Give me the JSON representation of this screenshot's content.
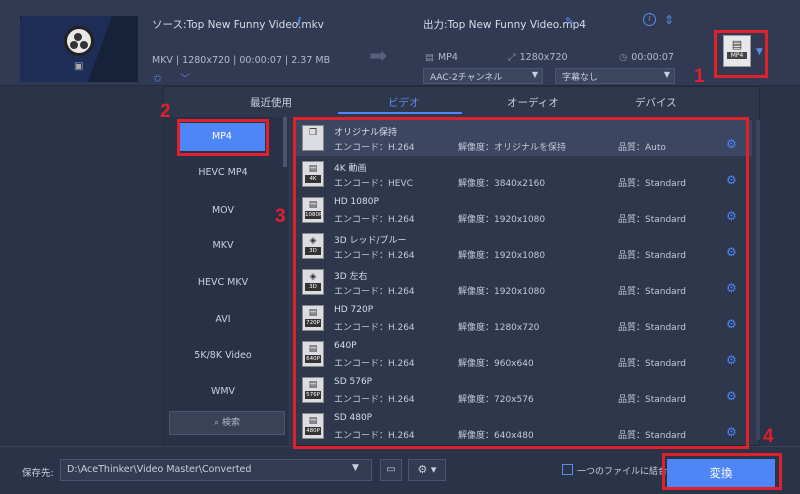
{
  "file": {
    "source_title": "ソース:Top New Funny Video.mkv",
    "source_meta": "MKV | 1280x720 | 00:00:07 | 2.37 MB",
    "output_title": "出力:Top New Funny Video.mp4",
    "output_format": "MP4",
    "output_resolution": "1280x720",
    "output_duration": "00:00:07",
    "audio_select": "AAC-2チャンネル",
    "subtitle_select": "字幕なし",
    "format_icon_label": "MP4"
  },
  "tabs": [
    {
      "label": "最近使用"
    },
    {
      "label": "ビデオ"
    },
    {
      "label": "オーディオ"
    },
    {
      "label": "デバイス"
    }
  ],
  "categories": [
    {
      "label": "MP4"
    },
    {
      "label": "HEVC MP4"
    },
    {
      "label": "MOV"
    },
    {
      "label": "MKV"
    },
    {
      "label": "HEVC MKV"
    },
    {
      "label": "AVI"
    },
    {
      "label": "5K/8K Video"
    },
    {
      "label": "WMV"
    }
  ],
  "search": {
    "label": "検索"
  },
  "presets": [
    {
      "icon": "",
      "name": "オリジナル保持",
      "encode": "エンコード：H.264",
      "resolution": "解像度：オリジナルを保持",
      "quality": "品質：Auto"
    },
    {
      "icon": "4K",
      "name": "4K 動画",
      "encode": "エンコード：HEVC",
      "resolution": "解像度：3840x2160",
      "quality": "品質：Standard"
    },
    {
      "icon": "1080P",
      "name": "HD 1080P",
      "encode": "エンコード：H.264",
      "resolution": "解像度：1920x1080",
      "quality": "品質：Standard"
    },
    {
      "icon": "3D",
      "name": "3D レッド/ブルー",
      "encode": "エンコード：H.264",
      "resolution": "解像度：1920x1080",
      "quality": "品質：Standard"
    },
    {
      "icon": "3D",
      "name": "3D 左右",
      "encode": "エンコード：H.264",
      "resolution": "解像度：1920x1080",
      "quality": "品質：Standard"
    },
    {
      "icon": "720P",
      "name": "HD 720P",
      "encode": "エンコード：H.264",
      "resolution": "解像度：1280x720",
      "quality": "品質：Standard"
    },
    {
      "icon": "640P",
      "name": "640P",
      "encode": "エンコード：H.264",
      "resolution": "解像度：960x640",
      "quality": "品質：Standard"
    },
    {
      "icon": "576P",
      "name": "SD 576P",
      "encode": "エンコード：H.264",
      "resolution": "解像度：720x576",
      "quality": "品質：Standard"
    },
    {
      "icon": "480P",
      "name": "SD 480P",
      "encode": "エンコード：H.264",
      "resolution": "解像度：640x480",
      "quality": "品質：Standard"
    }
  ],
  "bottom": {
    "save_label": "保存先:",
    "save_path": "D:\\AceThinker\\Video Master\\Converted",
    "merge_label": "一つのファイルに結合",
    "convert_label": "変換"
  },
  "annotations": [
    "1",
    "2",
    "3",
    "4"
  ],
  "colors": {
    "accent": "#4f86f7",
    "annotation": "#e0202a",
    "background": "#2b3348"
  }
}
